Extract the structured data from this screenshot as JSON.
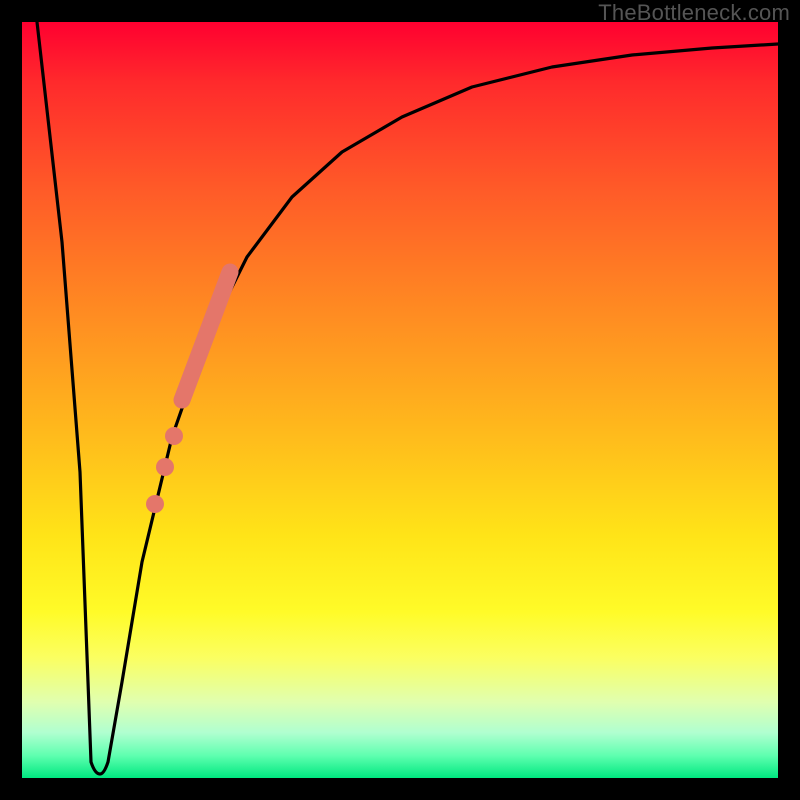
{
  "watermark": "TheBottleneck.com",
  "chart_data": {
    "type": "line",
    "title": "",
    "xlabel": "",
    "ylabel": "",
    "xlim": [
      0,
      100
    ],
    "ylim": [
      0,
      100
    ],
    "grid": false,
    "legend": false,
    "series": [
      {
        "name": "bottleneck-curve",
        "x": [
          2,
          4,
          6,
          8,
          9,
          10,
          11,
          13,
          16,
          20,
          24,
          28,
          33,
          38,
          45,
          55,
          65,
          75,
          85,
          95,
          100
        ],
        "y": [
          100,
          70,
          40,
          10,
          2,
          1,
          2,
          12,
          28,
          45,
          58,
          68,
          76,
          82,
          87,
          91,
          93.5,
          95,
          96,
          96.8,
          97
        ]
      }
    ],
    "markers": [
      {
        "name": "highlight-segment",
        "shape": "thick-line",
        "color": "#e4766a",
        "points": [
          {
            "x": 21.2,
            "y": 50
          },
          {
            "x": 27.7,
            "y": 67
          }
        ]
      },
      {
        "name": "highlight-dot-1",
        "shape": "circle",
        "color": "#e4766a",
        "x": 20.0,
        "y": 45
      },
      {
        "name": "highlight-dot-2",
        "shape": "circle",
        "color": "#e4766a",
        "x": 18.8,
        "y": 41
      },
      {
        "name": "highlight-dot-3",
        "shape": "circle",
        "color": "#e4766a",
        "x": 17.6,
        "y": 36
      }
    ],
    "background": {
      "type": "vertical-gradient",
      "stops": [
        {
          "pos": 0.0,
          "color": "#ff0030"
        },
        {
          "pos": 0.5,
          "color": "#ffb020"
        },
        {
          "pos": 0.78,
          "color": "#fffb28"
        },
        {
          "pos": 1.0,
          "color": "#00e880"
        }
      ]
    }
  }
}
